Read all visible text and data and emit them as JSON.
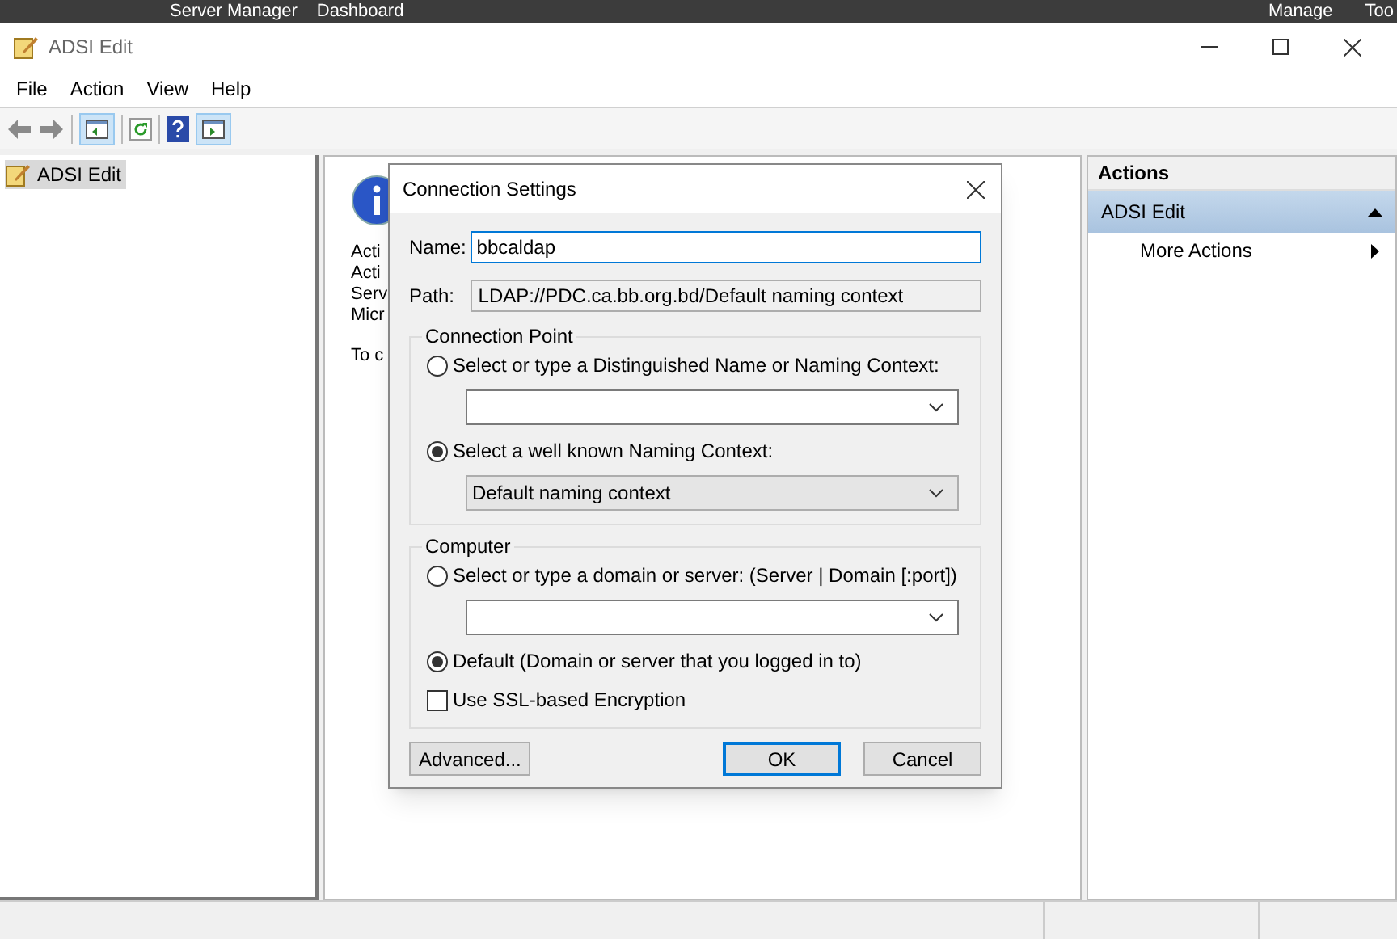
{
  "background": {
    "title_parts": [
      "Server Manager",
      "Dashboard"
    ],
    "menu": [
      "Manage",
      "Too"
    ]
  },
  "window": {
    "title": "ADSI Edit",
    "menu": [
      "File",
      "Action",
      "View",
      "Help"
    ]
  },
  "tree": {
    "items": [
      {
        "label": "ADSI Edit",
        "selected": true
      }
    ]
  },
  "info_pane": {
    "lines": [
      "Acti",
      "Acti",
      "Serv",
      "Micr"
    ],
    "footer": "To c"
  },
  "actions": {
    "header": "Actions",
    "sections": [
      {
        "title": "ADSI Edit",
        "expanded": true,
        "items": [
          {
            "label": "More Actions"
          }
        ]
      }
    ]
  },
  "dialog": {
    "title": "Connection Settings",
    "name_field": {
      "label": "Name:",
      "value": "bbcaldap"
    },
    "path_field": {
      "label": "Path:",
      "value": "LDAP://PDC.ca.bb.org.bd/Default naming context"
    },
    "groups": [
      {
        "title": "Connection Point",
        "options": [
          {
            "kind": "radio_combo",
            "label": "Select or type a Distinguished Name or Naming Context:",
            "selected": false,
            "combo_editable": true
          },
          {
            "kind": "radio_combo",
            "label": "Select a well known Naming Context:",
            "selected": true,
            "combo_editable": false,
            "combo_value": "Default naming context"
          }
        ]
      },
      {
        "title": "Computer",
        "options": [
          {
            "kind": "radio_combo",
            "label": "Select or type a domain or server: (Server | Domain [:port])",
            "selected": false,
            "combo_editable": true
          },
          {
            "kind": "radio",
            "label": "Default (Domain or server that you logged in to)",
            "selected": true
          }
        ],
        "checkbox": {
          "label": "Use SSL-based Encryption",
          "checked": false
        }
      }
    ],
    "buttons": [
      {
        "label": "Advanced...",
        "default": false
      },
      {
        "label": "OK",
        "default": true
      },
      {
        "label": "Cancel",
        "default": false
      }
    ]
  }
}
